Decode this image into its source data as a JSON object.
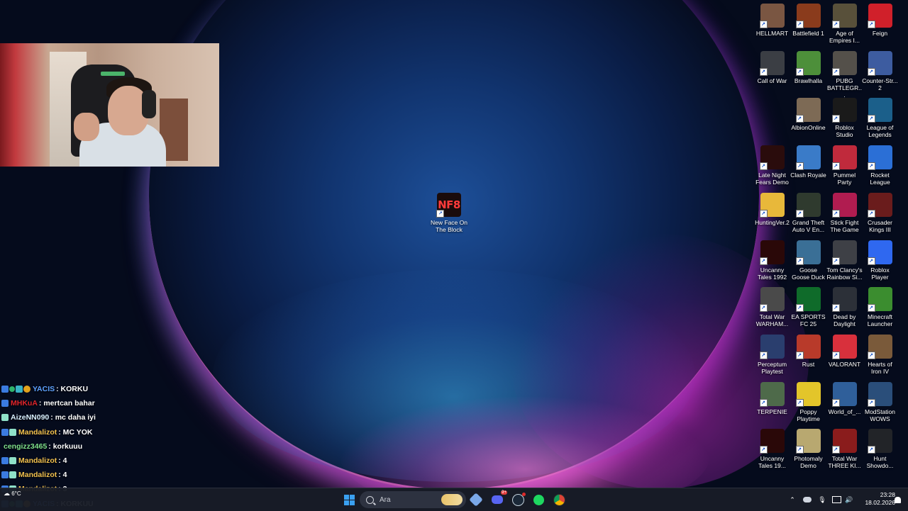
{
  "desktop": {
    "center_icon": {
      "label": "New Face On The Block",
      "badge": "NF8"
    },
    "icons": [
      {
        "label": "HELLMART",
        "color": "#7a5642"
      },
      {
        "label": "Battlefield 1",
        "color": "#8a3b1c"
      },
      {
        "label": "Age of Empires I...",
        "color": "#58503a"
      },
      {
        "label": "Feign",
        "color": "#d0202a"
      },
      {
        "label": "Call of War",
        "color": "#3b3e44"
      },
      {
        "label": "Brawlhalla",
        "color": "#4d8f3a"
      },
      {
        "label": "PUBG BATTLEGR...",
        "color": "#54504a"
      },
      {
        "label": "Counter-Str... 2",
        "color": "#3d5ca0"
      },
      {
        "label": "AlbionOnline",
        "color": "#7d6a55"
      },
      {
        "label": "Roblox Studio",
        "color": "#1a1a1a"
      },
      {
        "label": "League of Legends",
        "color": "#1b5f8a"
      },
      {
        "label": "Late Night Fears Demo",
        "color": "#2a0c0c"
      },
      {
        "label": "Clash Royale",
        "color": "#3a7bc8"
      },
      {
        "label": "Pummel Party",
        "color": "#c02a3c"
      },
      {
        "label": "Rocket League",
        "color": "#2b6fd6"
      },
      {
        "label": "HuntingVer.2",
        "color": "#e8b83a"
      },
      {
        "label": "Grand Theft Auto V En...",
        "color": "#2f3a2e"
      },
      {
        "label": "Stick Fight The Game",
        "color": "#b01c50"
      },
      {
        "label": "Crusader Kings III",
        "color": "#6a1c1c"
      },
      {
        "label": "Uncanny Tales 1992",
        "color": "#2a0808"
      },
      {
        "label": "Goose Goose Duck",
        "color": "#3a6f96"
      },
      {
        "label": "Tom Clancy's Rainbow Si...",
        "color": "#3e4046"
      },
      {
        "label": "Roblox Player",
        "color": "#2f68f0"
      },
      {
        "label": "Total War WARHAM...",
        "color": "#4a4a4a"
      },
      {
        "label": "EA SPORTS FC 25",
        "color": "#0f6b2a"
      },
      {
        "label": "Dead by Daylight",
        "color": "#2c3038"
      },
      {
        "label": "Minecraft Launcher",
        "color": "#3b8d2f"
      },
      {
        "label": "Perceptum Playtest",
        "color": "#2a3e6e"
      },
      {
        "label": "Rust",
        "color": "#b83a2a"
      },
      {
        "label": "VALORANT",
        "color": "#d8303c"
      },
      {
        "label": "Hearts of Iron IV",
        "color": "#7a5a3a"
      },
      {
        "label": "TERPENIE",
        "color": "#4e6a4a"
      },
      {
        "label": "Poppy Playtime",
        "color": "#e3c52a"
      },
      {
        "label": "World_of_...",
        "color": "#2f5f9a"
      },
      {
        "label": "ModStation WOWS",
        "color": "#2a4e7a"
      },
      {
        "label": "Uncanny Tales 19...",
        "color": "#2a0808"
      },
      {
        "label": "Photomaly Demo",
        "color": "#b8a870"
      },
      {
        "label": "Total War THREE KI...",
        "color": "#8a1c1c"
      },
      {
        "label": "Hunt Showdo...",
        "color": "#222428"
      }
    ]
  },
  "chat": {
    "messages": [
      {
        "user": "YACIS",
        "user_color": "#5ea2ff",
        "text": ": KORKU",
        "badges": [
          "b-blue",
          "b-green",
          "b-teal",
          "b-gold"
        ]
      },
      {
        "user": "MHKuA",
        "user_color": "#e0242a",
        "text": ": mertcan bahar",
        "badges": [
          "b-blue"
        ]
      },
      {
        "user": "AizeNN090",
        "user_color": "#d9f0ff",
        "text": ": mc daha iyi",
        "badges": [
          "b-grid"
        ]
      },
      {
        "user": "Mandalizot",
        "user_color": "#f2c14e",
        "text": ": MC YOK",
        "badges": [
          "b-blue",
          "b-grid"
        ]
      },
      {
        "user": "cengizz3465",
        "user_color": "#7fe08a",
        "text": ": korkuuu",
        "badges": []
      },
      {
        "user": "Mandalizot",
        "user_color": "#f2c14e",
        "text": ": 4",
        "badges": [
          "b-blue",
          "b-grid"
        ]
      },
      {
        "user": "Mandalizot",
        "user_color": "#f2c14e",
        "text": ": 4",
        "badges": [
          "b-blue",
          "b-grid"
        ]
      },
      {
        "user": "Mandalizot",
        "user_color": "#f2c14e",
        "text": ": 3",
        "badges": [
          "b-blue",
          "b-grid"
        ]
      },
      {
        "user": "YACIS",
        "user_color": "#5ea2ff",
        "text": ": KORKUU",
        "badges": [
          "b-blue",
          "b-green",
          "b-teal",
          "b-gold"
        ]
      }
    ]
  },
  "taskbar": {
    "search_placeholder": "Ara",
    "weather": "6°C",
    "time": "23:28",
    "date": "18.02.2026",
    "discord_badge": "9+"
  }
}
